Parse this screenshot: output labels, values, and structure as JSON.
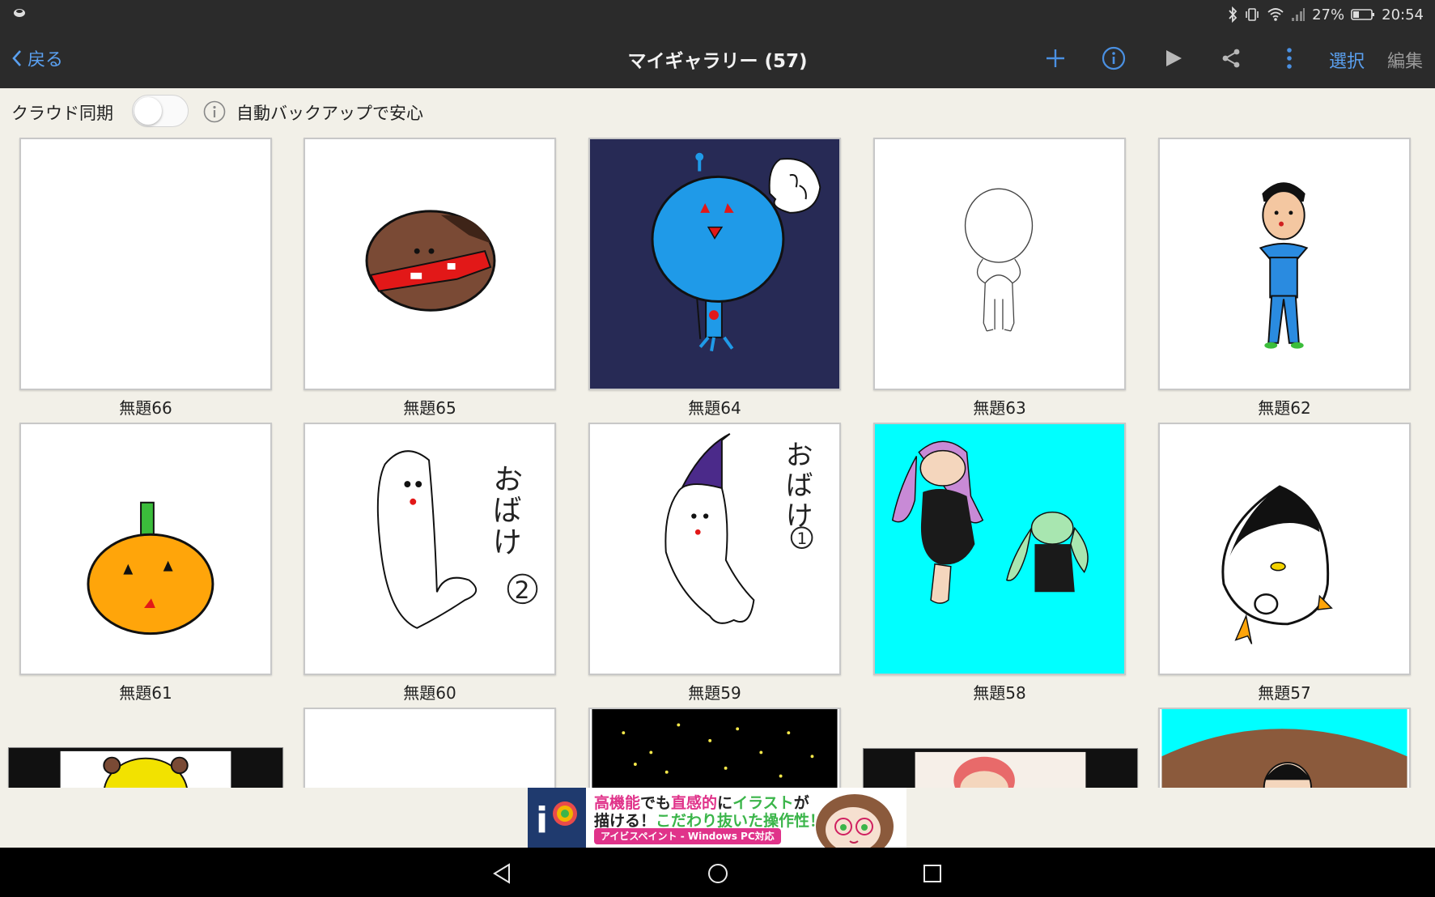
{
  "status": {
    "battery": "27%",
    "time": "20:54"
  },
  "header": {
    "back_label": "戻る",
    "title": "マイギャラリー (57)",
    "select_label": "選択",
    "edit_label": "編集"
  },
  "sync": {
    "label": "クラウド同期",
    "enabled": false,
    "backup_text": "自動バックアップで安心"
  },
  "gallery": {
    "items": [
      {
        "title": "無題66"
      },
      {
        "title": "無題65"
      },
      {
        "title": "無題64"
      },
      {
        "title": "無題63"
      },
      {
        "title": "無題62"
      },
      {
        "title": "無題61"
      },
      {
        "title": "無題60"
      },
      {
        "title": "無題59"
      },
      {
        "title": "無題58"
      },
      {
        "title": "無題57"
      }
    ]
  },
  "ad": {
    "line1_a": "高機能",
    "line1_b": "でも",
    "line1_c": "直感的",
    "line1_d": "に",
    "line1_e": "イラスト",
    "line1_f": "が",
    "line2_a": "描ける！",
    "line2_b": "こだわり抜いた操作性！",
    "line3": "アイビスペイント - Windows PC対応"
  },
  "icons": {
    "add": "plus-icon",
    "info": "info-icon",
    "play": "play-icon",
    "share": "share-icon",
    "more": "more-vertical-icon"
  },
  "colors": {
    "accent": "#5aa0f0",
    "appbar": "#2b2b2b",
    "background": "#f2f0e8"
  }
}
